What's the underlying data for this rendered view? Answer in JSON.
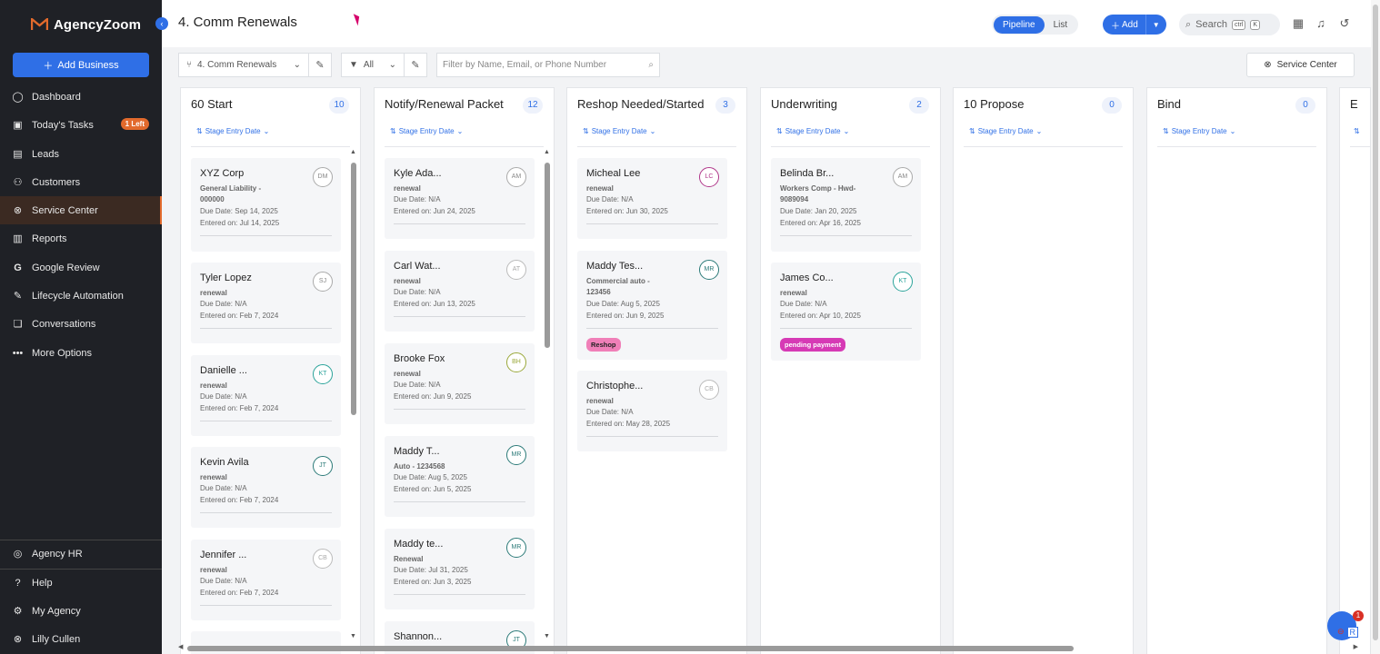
{
  "app": {
    "name": "AgencyZoom",
    "brand_color": "#e26a2c",
    "accent_color": "#2f6fe6"
  },
  "sidebar": {
    "add_business_label": "Add Business",
    "items": [
      {
        "label": "Dashboard",
        "icon": "dashboard-icon"
      },
      {
        "label": "Today's Tasks",
        "icon": "tasks-icon",
        "badge": "1 Left"
      },
      {
        "label": "Leads",
        "icon": "leads-icon"
      },
      {
        "label": "Customers",
        "icon": "customers-icon"
      },
      {
        "label": "Service Center",
        "icon": "service-center-icon",
        "active": true
      },
      {
        "label": "Reports",
        "icon": "reports-icon"
      },
      {
        "label": "Google Review",
        "icon": "google-icon"
      },
      {
        "label": "Lifecycle Automation",
        "icon": "automation-icon"
      },
      {
        "label": "Conversations",
        "icon": "conversations-icon"
      },
      {
        "label": "More Options",
        "icon": "more-icon"
      }
    ],
    "bottom_items": [
      {
        "label": "Agency HR",
        "icon": "agency-hr-icon"
      },
      {
        "label": "Help",
        "icon": "help-icon"
      },
      {
        "label": "My Agency",
        "icon": "settings-icon"
      },
      {
        "label": "Lilly Cullen",
        "icon": "user-icon"
      }
    ]
  },
  "header": {
    "title": "4. Comm Renewals",
    "view_options": [
      "Pipeline",
      "List"
    ],
    "active_view": "Pipeline",
    "add_label": "Add",
    "search_placeholder": "Search",
    "search_shortcut": [
      "ctrl",
      "K"
    ]
  },
  "filterbar": {
    "pipeline_select": "4. Comm Renewals",
    "owner_select": "All",
    "filter_placeholder": "Filter by Name, Email, or Phone Number",
    "service_center_label": "Service Center"
  },
  "columns": [
    {
      "title": "60 Start",
      "count": "10",
      "sort_label": "Stage Entry Date",
      "cards": [
        {
          "name": "XYZ Corp",
          "avatar": "DM",
          "sub": "General Liability - 000000",
          "due": "Due Date: Sep 14, 2025",
          "entered": "Entered on: Jul 14, 2025"
        },
        {
          "name": "Tyler Lopez",
          "avatar": "SJ",
          "sub": "renewal",
          "due": "Due Date: N/A",
          "entered": "Entered on: Feb 7, 2024"
        },
        {
          "name": "Danielle ...",
          "avatar": "KT",
          "sub": "renewal",
          "due": "Due Date: N/A",
          "entered": "Entered on: Feb 7, 2024"
        },
        {
          "name": "Kevin Avila",
          "avatar": "JT",
          "sub": "renewal",
          "due": "Due Date: N/A",
          "entered": "Entered on: Feb 7, 2024"
        },
        {
          "name": "Jennifer ...",
          "avatar": "CB",
          "sub": "renewal",
          "due": "Due Date: N/A",
          "entered": "Entered on: Feb 7, 2024"
        }
      ]
    },
    {
      "title": "Notify/Renewal Packet",
      "count": "12",
      "sort_label": "Stage Entry Date",
      "cards": [
        {
          "name": "Kyle Ada...",
          "avatar": "AM",
          "sub": "renewal",
          "due": "Due Date: N/A",
          "entered": "Entered on: Jun 24, 2025"
        },
        {
          "name": "Carl Wat...",
          "avatar": "AT",
          "sub": "renewal",
          "due": "Due Date: N/A",
          "entered": "Entered on: Jun 13, 2025"
        },
        {
          "name": "Brooke Fox",
          "avatar": "BH",
          "sub": "renewal",
          "due": "Due Date: N/A",
          "entered": "Entered on: Jun 9, 2025"
        },
        {
          "name": "Maddy T...",
          "avatar": "MR",
          "sub": "Auto - 1234568",
          "due": "Due Date: Aug 5, 2025",
          "entered": "Entered on: Jun 5, 2025"
        },
        {
          "name": "Maddy te...",
          "avatar": "MR",
          "sub": "Renewal",
          "due": "Due Date: Jul 31, 2025",
          "entered": "Entered on: Jun 3, 2025"
        },
        {
          "name": "Shannon...",
          "avatar": "JT",
          "sub": "",
          "due": "",
          "entered": ""
        }
      ]
    },
    {
      "title": "Reshop Needed/Started",
      "count": "3",
      "sort_label": "Stage Entry Date",
      "cards": [
        {
          "name": "Micheal Lee",
          "avatar": "LC",
          "sub": "renewal",
          "due": "Due Date: N/A",
          "entered": "Entered on: Jun 30, 2025"
        },
        {
          "name": "Maddy Tes...",
          "avatar": "MR",
          "sub": "Commercial auto - 123456",
          "due": "Due Date: Aug 5, 2025",
          "entered": "Entered on: Jun 9, 2025",
          "tag": "Reshop"
        },
        {
          "name": "Christophe...",
          "avatar": "CB",
          "sub": "renewal",
          "due": "Due Date: N/A",
          "entered": "Entered on: May 28, 2025"
        }
      ]
    },
    {
      "title": "Underwriting",
      "count": "2",
      "sort_label": "Stage Entry Date",
      "cards": [
        {
          "name": "Belinda Br...",
          "avatar": "AM",
          "sub": "Workers Comp - Hwd-9089094",
          "due": "Due Date: Jan 20, 2025",
          "entered": "Entered on: Apr 16, 2025"
        },
        {
          "name": "James Co...",
          "avatar": "KT",
          "sub": "renewal",
          "due": "Due Date: N/A",
          "entered": "Entered on: Apr 10, 2025",
          "tag": "pending payment"
        }
      ]
    },
    {
      "title": "10 Propose",
      "count": "0",
      "sort_label": "Stage Entry Date",
      "cards": []
    },
    {
      "title": "Bind",
      "count": "0",
      "sort_label": "Stage Entry Date",
      "cards": []
    },
    {
      "title": "E",
      "count": "",
      "sort_label": "",
      "cards": []
    }
  ],
  "chat": {
    "badge": "1"
  }
}
